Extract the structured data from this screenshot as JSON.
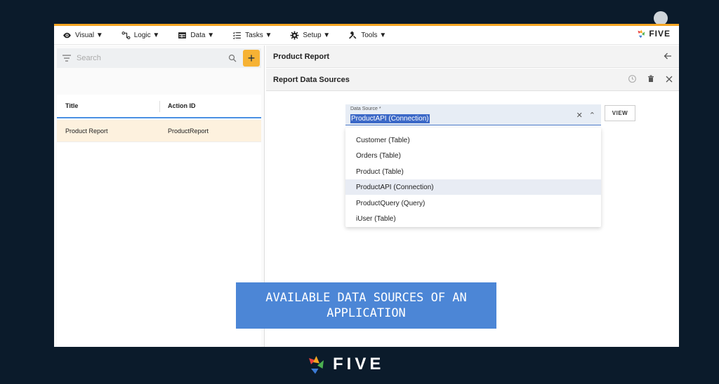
{
  "menu": [
    {
      "label": "Visual ▼",
      "icon": "eye-icon"
    },
    {
      "label": "Logic ▼",
      "icon": "logic-icon"
    },
    {
      "label": "Data ▼",
      "icon": "table-icon"
    },
    {
      "label": "Tasks ▼",
      "icon": "tasks-icon"
    },
    {
      "label": "Setup ▼",
      "icon": "gear-icon"
    },
    {
      "label": "Tools ▼",
      "icon": "tools-icon"
    }
  ],
  "brand": {
    "name": "FIVE"
  },
  "search": {
    "placeholder": "Search"
  },
  "list": {
    "columns": [
      "Title",
      "Action ID"
    ],
    "rows": [
      [
        "Product Report",
        "ProductReport"
      ]
    ]
  },
  "panel": {
    "title": "Product Report",
    "subtitle": "Report Data Sources",
    "field_label": "Data Source *",
    "field_value": "ProductAPI (Connection)",
    "view_label": "VIEW",
    "options": [
      "Customer (Table)",
      "Orders (Table)",
      "Product (Table)",
      "ProductAPI (Connection)",
      "ProductQuery (Query)",
      "iUser (Table)"
    ],
    "selected_option": "ProductAPI (Connection)"
  },
  "caption": {
    "line1": "AVAILABLE DATA SOURCES OF AN",
    "line2": "APPLICATION"
  },
  "footer": {
    "brand": "FIVE"
  },
  "colors": {
    "accent": "#f5a623",
    "add_button": "#f6b234",
    "caption_bg": "#4c86d6",
    "background": "#0b1b2b"
  }
}
